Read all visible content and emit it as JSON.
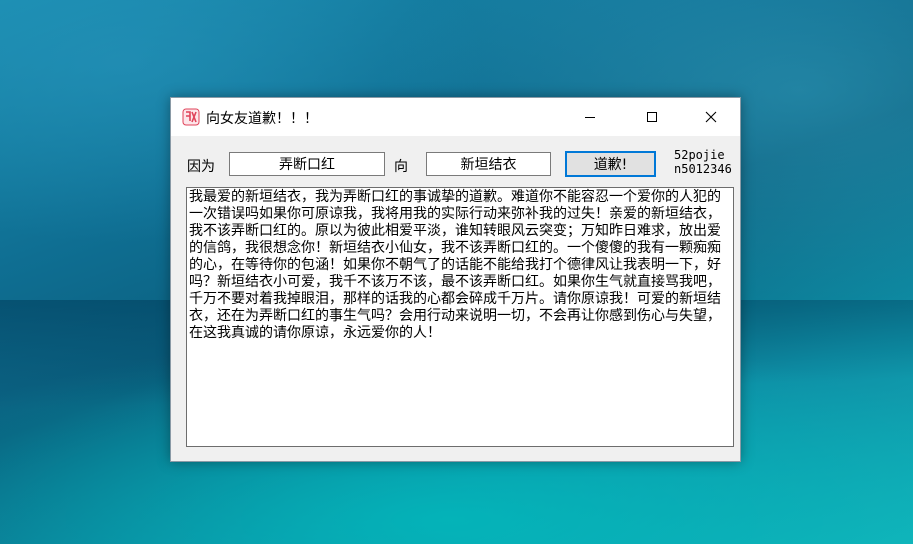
{
  "window": {
    "title": "向女友道歉！！！",
    "controls": {
      "minimize_icon": "minimize-icon",
      "maximize_icon": "maximize-icon",
      "close_icon": "close-icon"
    }
  },
  "form": {
    "because_label": "因为",
    "reason_value": "弄断口红",
    "to_label": "向",
    "name_value": "新垣结衣",
    "apologize_label": "道歉!",
    "credit_line1": "52pojie",
    "credit_line2": "n5012346",
    "message": "我最爱的新垣结衣，我为弄断口红的事诚挚的道歉。难道你不能容忍一个爱你的人犯的一次错误吗如果你可原谅我，我将用我的实际行动来弥补我的过失！亲爱的新垣结衣，我不该弄断口红的。原以为彼此相爱平淡，谁知转眼风云突变；万知昨日难求，放出爱的信鸽，我很想念你！新垣结衣小仙女，我不该弄断口红的。一个傻傻的我有一颗痴痴的心，在等待你的包涵！如果你不朝气了的话能不能给我打个德律风让我表明一下，好吗？新垣结衣小可爱，我千不该万不该，最不该弄断口红。如果你生气就直接骂我吧，千万不要对着我掉眼泪，那样的话我的心都会碎成千万片。请你原谅我！可爱的新垣结衣，还在为弄断口红的事生气吗？会用行动来说明一切，不会再让你感到伤心与失望，在这我真诚的请你原谅，永远爱你的人！"
  },
  "colors": {
    "accent": "#0078d7",
    "window_bg": "#f0f0f0",
    "titlebar_bg": "#ffffff",
    "icon_red": "#e0435a"
  },
  "icons": {
    "app": "app-logo-icon"
  }
}
